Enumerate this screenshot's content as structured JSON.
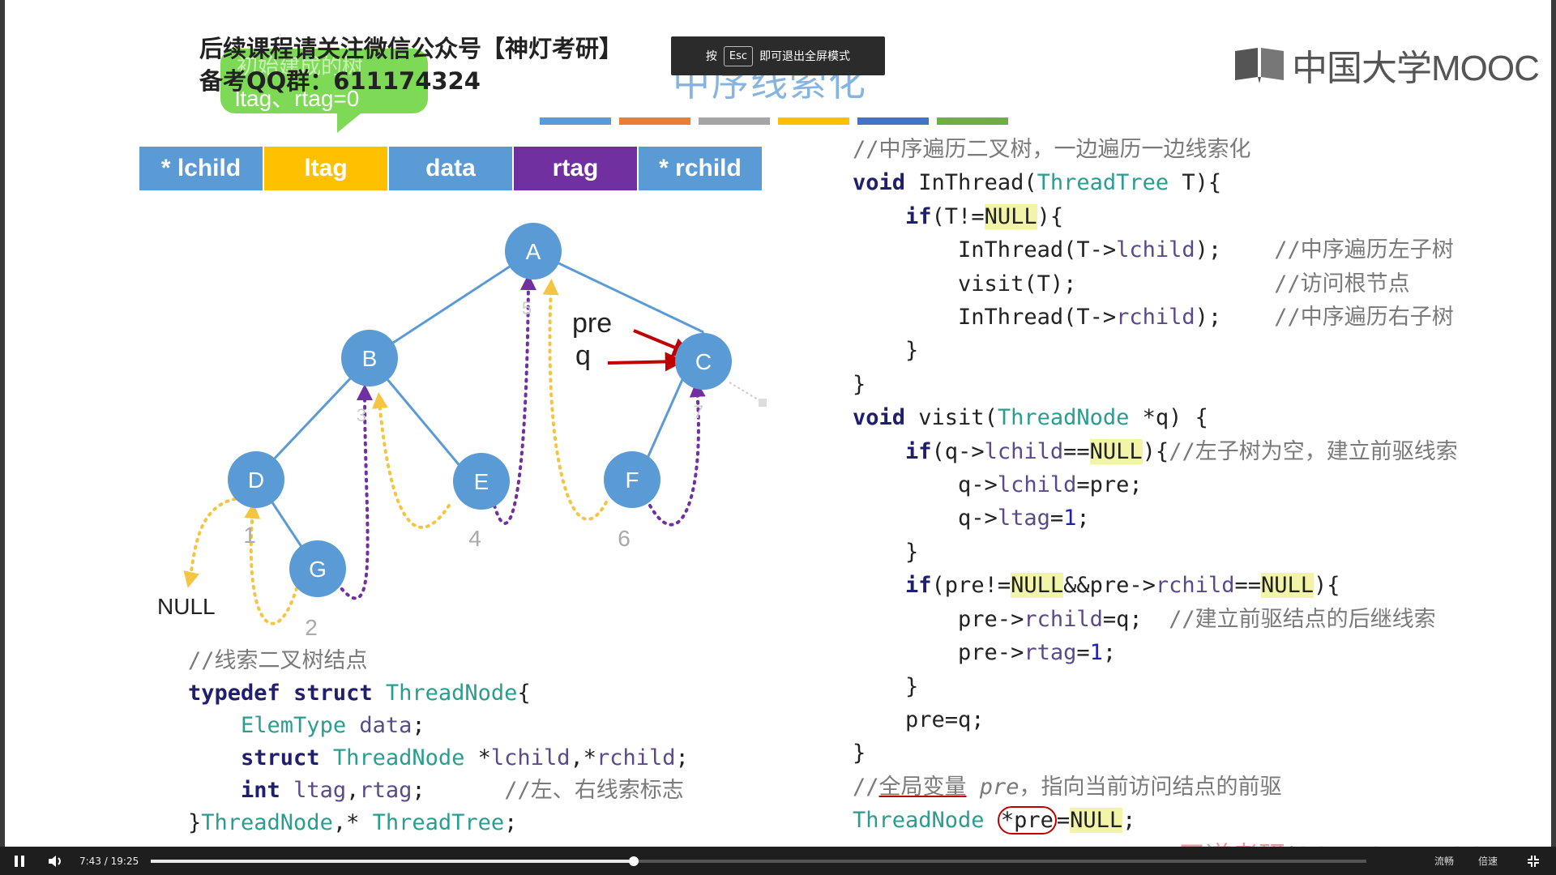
{
  "overlay": {
    "notice_line1": "后续课程请关注微信公众号【神灯考研】",
    "notice_line2": "备考QQ群：611174324",
    "bubble_text": "ltag、rtag=0",
    "bubble_faint": "初始建成的树",
    "esc_prefix": "按",
    "esc_key": "Esc",
    "esc_suffix": "即可退出全屏模式"
  },
  "slide": {
    "title": "中序线索化",
    "logo_text": "中国大学MOOC",
    "strip_colors": [
      "#5b9bd5",
      "#ed7d31",
      "#a5a5a5",
      "#ffc000",
      "#4472c4",
      "#70ad47"
    ],
    "node_fields": [
      {
        "label": "* lchild",
        "color": "#5b9bd5"
      },
      {
        "label": "ltag",
        "color": "#ffc000"
      },
      {
        "label": "data",
        "color": "#5b9bd5"
      },
      {
        "label": "rtag",
        "color": "#7030a0"
      },
      {
        "label": "* rchild",
        "color": "#5b9bd5"
      }
    ],
    "tree": {
      "nodes": [
        "A",
        "B",
        "C",
        "D",
        "E",
        "F",
        "G"
      ],
      "pre_label": "pre",
      "q_label": "q",
      "null_label": "NULL",
      "step_numbers": [
        "1",
        "2",
        "3",
        "4",
        "5",
        "6",
        "7"
      ]
    },
    "watermark": "王道考研/CSKAOYAN.COM"
  },
  "code_right": {
    "c1": "//中序遍历二叉树，一边遍历一边线索化",
    "c2": "//中序遍历左子树",
    "c3": "//访问根节点",
    "c4": "//中序遍历右子树",
    "c5": "//左子树为空，建立前驱线索",
    "c6": "//建立前驱结点的后继线索",
    "c7a": "//",
    "c7b": "全局变量",
    "c7c": " pre",
    "c7d": "，指向当前访问结点的前驱"
  },
  "code_left": {
    "c1": "//线索二叉树结点",
    "c2": "//左、右线索标志"
  },
  "player": {
    "current_time": "7:43",
    "total_time": "19:25",
    "progress": 0.397,
    "speed_label": "倍速",
    "quality_label": "流畅"
  }
}
